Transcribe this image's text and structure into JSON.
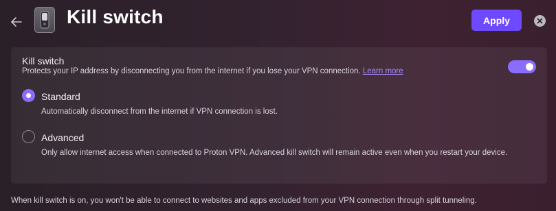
{
  "header": {
    "title": "Kill switch",
    "apply_label": "Apply",
    "back_icon": "arrow-left-icon",
    "close_icon": "close-icon"
  },
  "card": {
    "kill_switch_title": "Kill switch",
    "kill_switch_desc": "Protects your IP address by disconnecting you from the internet if you lose your VPN connection.",
    "learn_more": "Learn more",
    "toggle_on": true,
    "options": [
      {
        "label": "Standard",
        "desc": "Automatically disconnect from the internet if VPN connection is lost.",
        "selected": true
      },
      {
        "label": "Advanced",
        "desc": "Only allow internet access when connected to Proton VPN. Advanced kill switch will remain active even when you restart your device.",
        "selected": false
      }
    ]
  },
  "footer": {
    "note": "When kill switch is on, you won't be able to connect to websites and apps excluded from your VPN connection through split tunneling."
  },
  "colors": {
    "accent": "#6d4aff",
    "toggle": "#8a6dff",
    "link": "#a58bff"
  }
}
